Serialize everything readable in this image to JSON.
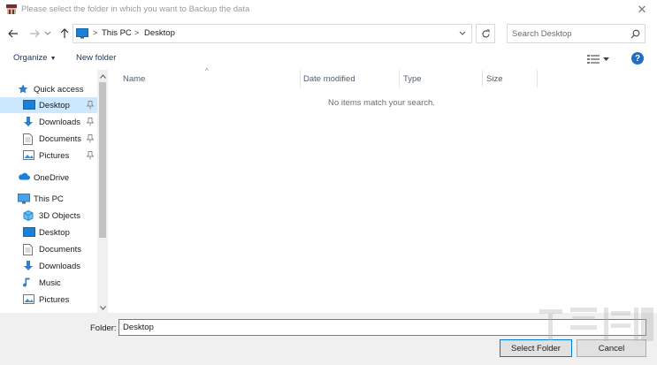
{
  "window": {
    "title": "Please select the folder in which you want to Backup the data",
    "app_icon": "backup-app-icon",
    "close_glyph": "✕"
  },
  "address_bar": {
    "crumbs": [
      "This PC",
      "Desktop"
    ],
    "separator": ">",
    "icon": "this-pc-icon"
  },
  "search": {
    "placeholder": "Search Desktop"
  },
  "toolbar": {
    "organize_label": "Organize",
    "new_folder_label": "New folder",
    "help_label": "?"
  },
  "nav_pane": {
    "items": [
      {
        "label": "Quick access",
        "icon": "star-icon",
        "level": 0,
        "pinned": false,
        "selected": false
      },
      {
        "label": "Desktop",
        "icon": "desktop-folder-icon",
        "level": 1,
        "pinned": true,
        "selected": true
      },
      {
        "label": "Downloads",
        "icon": "download-arrow-icon",
        "level": 1,
        "pinned": true,
        "selected": false
      },
      {
        "label": "Documents",
        "icon": "document-icon",
        "level": 1,
        "pinned": true,
        "selected": false
      },
      {
        "label": "Pictures",
        "icon": "pictures-icon",
        "level": 1,
        "pinned": true,
        "selected": false
      },
      {
        "label": "OneDrive",
        "icon": "cloud-icon",
        "level": 0,
        "pinned": false,
        "selected": false
      },
      {
        "label": "This PC",
        "icon": "monitor-icon",
        "level": 0,
        "pinned": false,
        "selected": false
      },
      {
        "label": "3D Objects",
        "icon": "cube-icon",
        "level": 1,
        "pinned": false,
        "selected": false
      },
      {
        "label": "Desktop",
        "icon": "desktop-folder-icon",
        "level": 1,
        "pinned": false,
        "selected": false
      },
      {
        "label": "Documents",
        "icon": "document-icon",
        "level": 1,
        "pinned": false,
        "selected": false
      },
      {
        "label": "Downloads",
        "icon": "download-arrow-icon",
        "level": 1,
        "pinned": false,
        "selected": false
      },
      {
        "label": "Music",
        "icon": "music-note-icon",
        "level": 1,
        "pinned": false,
        "selected": false
      },
      {
        "label": "Pictures",
        "icon": "pictures-icon",
        "level": 1,
        "pinned": false,
        "selected": false
      }
    ]
  },
  "file_list": {
    "columns": [
      "Name",
      "Date modified",
      "Type",
      "Size"
    ],
    "empty_message": "No items match your search."
  },
  "bottom": {
    "folder_label": "Folder:",
    "folder_value": "Desktop",
    "select_label": "Select Folder",
    "cancel_label": "Cancel"
  },
  "colors": {
    "accent": "#0078d7",
    "selection": "#cce8ff",
    "help_blue": "#1f6fc5"
  }
}
